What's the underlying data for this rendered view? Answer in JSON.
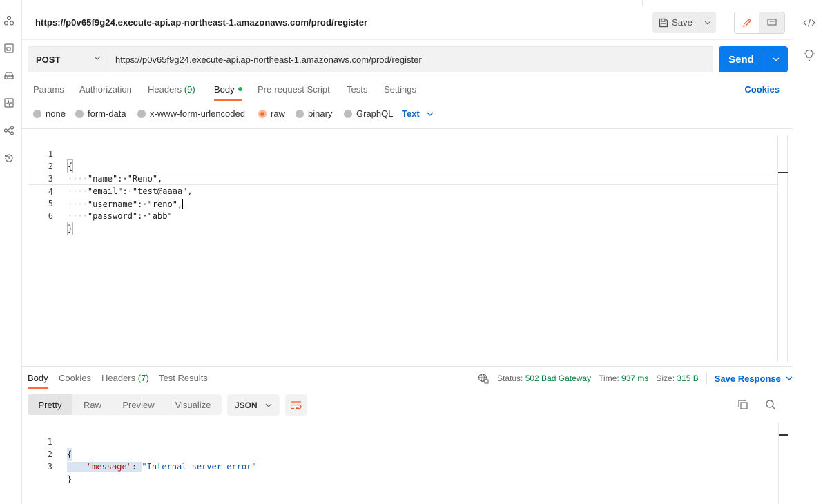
{
  "request": {
    "title": "https://p0v65f9g24.execute-api.ap-northeast-1.amazonaws.com/prod/register",
    "method": "POST",
    "url": "https://p0v65f9g24.execute-api.ap-northeast-1.amazonaws.com/prod/register",
    "save_label": "Save",
    "send_label": "Send"
  },
  "request_tabs": {
    "params": "Params",
    "authorization": "Authorization",
    "headers": "Headers",
    "headers_count": "(9)",
    "body": "Body",
    "prerequest": "Pre-request Script",
    "tests": "Tests",
    "settings": "Settings",
    "cookies": "Cookies"
  },
  "body_types": {
    "none": "none",
    "form_data": "form-data",
    "urlencoded": "x-www-form-urlencoded",
    "raw": "raw",
    "binary": "binary",
    "graphql": "GraphQL",
    "format": "Text"
  },
  "request_body": {
    "lines": [
      {
        "n": "1",
        "indent": "",
        "text": "{"
      },
      {
        "n": "2",
        "indent": "····",
        "text": "\"name\":·\"Reno\","
      },
      {
        "n": "3",
        "indent": "····",
        "text": "\"email\":·\"test@aaaa\","
      },
      {
        "n": "4",
        "indent": "····",
        "text": "\"username\":·\"reno\","
      },
      {
        "n": "5",
        "indent": "····",
        "text": "\"password\":·\"abb\""
      },
      {
        "n": "6",
        "indent": "",
        "text": "}"
      }
    ]
  },
  "response_tabs": {
    "body": "Body",
    "cookies": "Cookies",
    "headers": "Headers",
    "headers_count": "(7)",
    "test_results": "Test Results"
  },
  "response_meta": {
    "status_label": "Status:",
    "status_value": "502 Bad Gateway",
    "time_label": "Time:",
    "time_value": "937 ms",
    "size_label": "Size:",
    "size_value": "315 B",
    "save_response": "Save Response"
  },
  "view_tabs": {
    "pretty": "Pretty",
    "raw": "Raw",
    "preview": "Preview",
    "visualize": "Visualize",
    "format": "JSON"
  },
  "response_body": {
    "line1_n": "1",
    "line1": "{",
    "line2_n": "2",
    "line2_key": "\"message\"",
    "line2_sep": ": ",
    "line2_val": "\"Internal server error\"",
    "line3_n": "3",
    "line3": "}"
  },
  "colors": {
    "accent": "#ff6c37",
    "send": "#097bed",
    "link": "#0265d2",
    "status_ok": "#0a7d3a"
  }
}
